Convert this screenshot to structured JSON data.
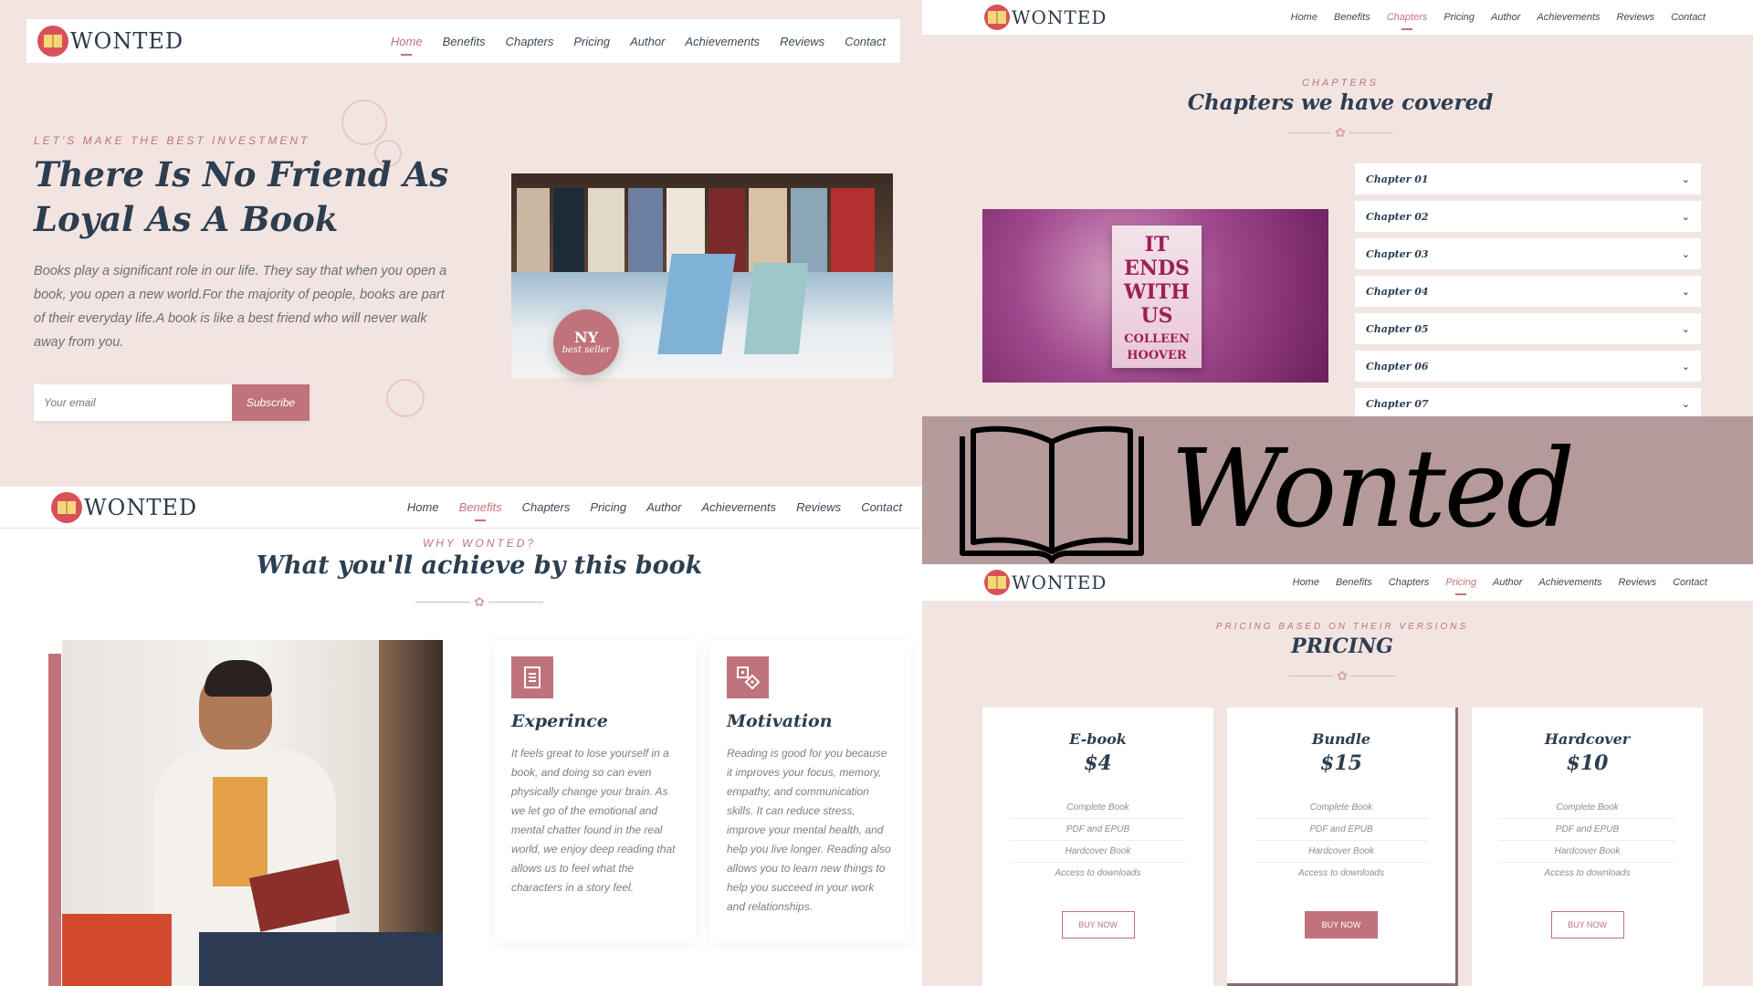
{
  "brand": {
    "name": "WONTED",
    "wordmark": "Wonted"
  },
  "nav": [
    "Home",
    "Benefits",
    "Chapters",
    "Pricing",
    "Author",
    "Achievements",
    "Reviews",
    "Contact"
  ],
  "hero": {
    "kicker": "LET'S MAKE THE BEST INVESTMENT",
    "title_line1": "There Is No Friend As",
    "title_line2": "Loyal As A Book",
    "body": "Books play a significant role in our life. They say that when you open a book, you open a new world.For the majority of people, books are part of their everyday life.A book is like a best friend who will never walk away from you.",
    "email_placeholder": "Your email",
    "subscribe": "Subscribe",
    "badge_top": "NY",
    "badge_bottom": "best seller"
  },
  "benefits": {
    "kicker": "WHY WONTED?",
    "title": "What you'll achieve by this book",
    "cards": [
      {
        "title": "Experince",
        "icon": "document-icon",
        "text": "It feels great to lose yourself in a book, and doing so can even physically change your brain. As we let go of the emotional and mental chatter found in the real world, we enjoy deep reading that allows us to feel what the characters in a story feel."
      },
      {
        "title": "Motivation",
        "icon": "dice-icon",
        "text": "Reading is good for you because it improves your focus, memory, empathy, and communication skills. It can reduce stress, improve your mental health, and help you live longer. Reading also allows you to learn new things to help you succeed in your work and relationships."
      }
    ]
  },
  "chapters": {
    "kicker": "CHAPTERS",
    "title": "Chapters we have covered",
    "book_title": "IT ENDS WITH US",
    "book_author": "COLLEEN HOOVER",
    "items": [
      "Chapter 01",
      "Chapter 02",
      "Chapter 03",
      "Chapter 04",
      "Chapter 05",
      "Chapter 06",
      "Chapter 07"
    ]
  },
  "pricing": {
    "kicker": "PRICING BASED ON THEIR VERSIONS",
    "title": "PRICING",
    "plans": [
      {
        "name": "E-book",
        "price": "$4",
        "features": [
          "Complete Book",
          "PDF and EPUB",
          "Hardcover Book",
          "Access to downloads"
        ],
        "cta": "BUY NOW"
      },
      {
        "name": "Bundle",
        "price": "$15",
        "features": [
          "Complete Book",
          "PDF and EPUB",
          "Hardcover Book",
          "Access to downloads"
        ],
        "cta": "BUY NOW"
      },
      {
        "name": "Hardcover",
        "price": "$10",
        "features": [
          "Complete Book",
          "PDF and EPUB",
          "Hardcover Book",
          "Access to downloads"
        ],
        "cta": "BUY NOW"
      }
    ]
  },
  "colors": {
    "accent": "#c0737a",
    "blush_bg": "#f2e4e1",
    "banner_bg": "#b49a9b",
    "navy": "#2c3e50"
  }
}
